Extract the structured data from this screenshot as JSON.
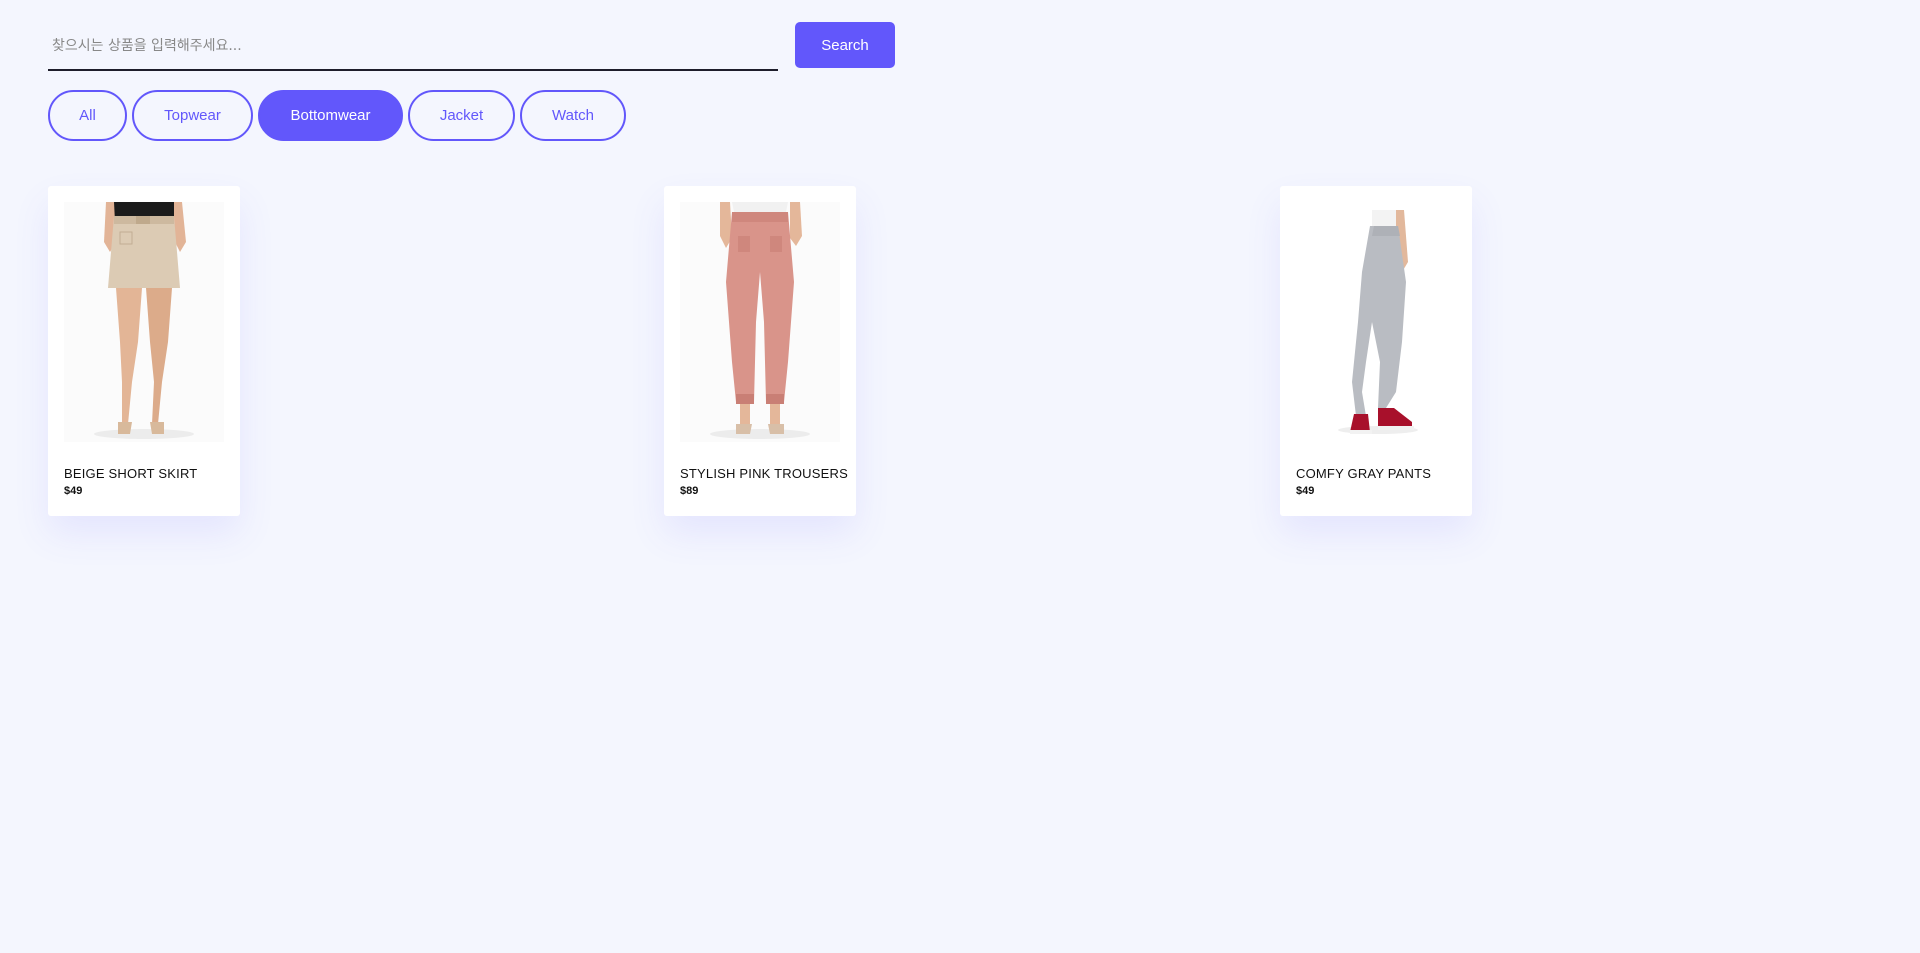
{
  "search": {
    "placeholder": "찾으시는 상품을 입력해주세요...",
    "value": "",
    "button_label": "Search"
  },
  "filters": {
    "items": [
      {
        "label": "All",
        "active": false
      },
      {
        "label": "Topwear",
        "active": false
      },
      {
        "label": "Bottomwear",
        "active": true
      },
      {
        "label": "Jacket",
        "active": false
      },
      {
        "label": "Watch",
        "active": false
      }
    ]
  },
  "products": [
    {
      "name": "BEIGE SHORT SKIRT",
      "price": "$49",
      "image": "beige-short-skirt-photo"
    },
    {
      "name": "STYLISH PINK TROUSERS",
      "price": "$89",
      "image": "pink-trousers-photo"
    },
    {
      "name": "COMFY GRAY PANTS",
      "price": "$49",
      "image": "gray-pants-photo"
    }
  ],
  "colors": {
    "accent": "#6257fb",
    "background": "#f4f6fe",
    "card": "#ffffff",
    "text": "#111111"
  }
}
